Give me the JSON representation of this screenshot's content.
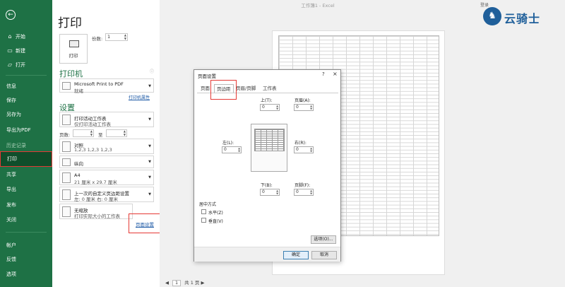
{
  "window": {
    "title": "工作簿1 - Excel",
    "login": "登录"
  },
  "logo": {
    "text": "云骑士"
  },
  "nav": {
    "items": [
      {
        "label": "开始",
        "icon": "home-icon"
      },
      {
        "label": "新建",
        "icon": "new-doc-icon"
      },
      {
        "label": "打开",
        "icon": "folder-open-icon"
      },
      {
        "label": "信息"
      },
      {
        "label": "保存"
      },
      {
        "label": "另存为"
      },
      {
        "label": "导出为PDF"
      },
      {
        "label": "历史记录"
      },
      {
        "label": "打印"
      },
      {
        "label": "共享"
      },
      {
        "label": "导出"
      },
      {
        "label": "发布"
      },
      {
        "label": "关闭"
      },
      {
        "label": "帐户"
      },
      {
        "label": "反馈"
      },
      {
        "label": "选项"
      }
    ]
  },
  "print": {
    "title": "打印",
    "copies_label": "份数:",
    "copies_value": "1",
    "print_button": "打印",
    "printer_section": "打印机",
    "printer_name": "Microsoft Print to PDF",
    "printer_status": "就绪",
    "printer_props_link": "打印机属性",
    "settings_section": "设置",
    "opt_what_1": "打印活动工作表",
    "opt_what_2": "仅打印活动工作表",
    "pages_label": "页数:",
    "pages_to": "至",
    "opt_collate_1": "对照",
    "opt_collate_2": "1,2,3    1,2,3    1,2,3",
    "opt_orient": "纵向",
    "opt_paper_1": "A4",
    "opt_paper_2": "21 厘米 x 29.7 厘米",
    "opt_margin_1": "上一次的自定义页边距设置",
    "opt_margin_2": "左: 0 厘米    右: 0 厘米",
    "opt_scale_1": "无缩放",
    "opt_scale_2": "打印实际大小的工作表",
    "page_setup_link": "页面设置"
  },
  "pager": {
    "current": "1",
    "total": "共 1 页"
  },
  "dialog": {
    "title": "页面设置",
    "help": "?",
    "close": "×",
    "tabs": [
      "页面",
      "页边距",
      "页眉/页脚",
      "工作表"
    ],
    "top_label": "上(T):",
    "top_value": "0",
    "header_label": "页眉(A):",
    "header_value": "0",
    "left_label": "左(L):",
    "left_value": "0",
    "right_label": "右(R):",
    "right_value": "0",
    "bottom_label": "下(B):",
    "bottom_value": "0",
    "footer_label": "页脚(F):",
    "footer_value": "0",
    "center_title": "居中方式",
    "horiz_label": "水平(Z)",
    "vert_label": "垂直(V)",
    "options_button": "选项(O)...",
    "ok_button": "确定",
    "cancel_button": "取消"
  },
  "colors": {
    "nav_green": "#1e7145",
    "highlight_red": "#e53935",
    "logo_blue": "#1f5f9a"
  }
}
